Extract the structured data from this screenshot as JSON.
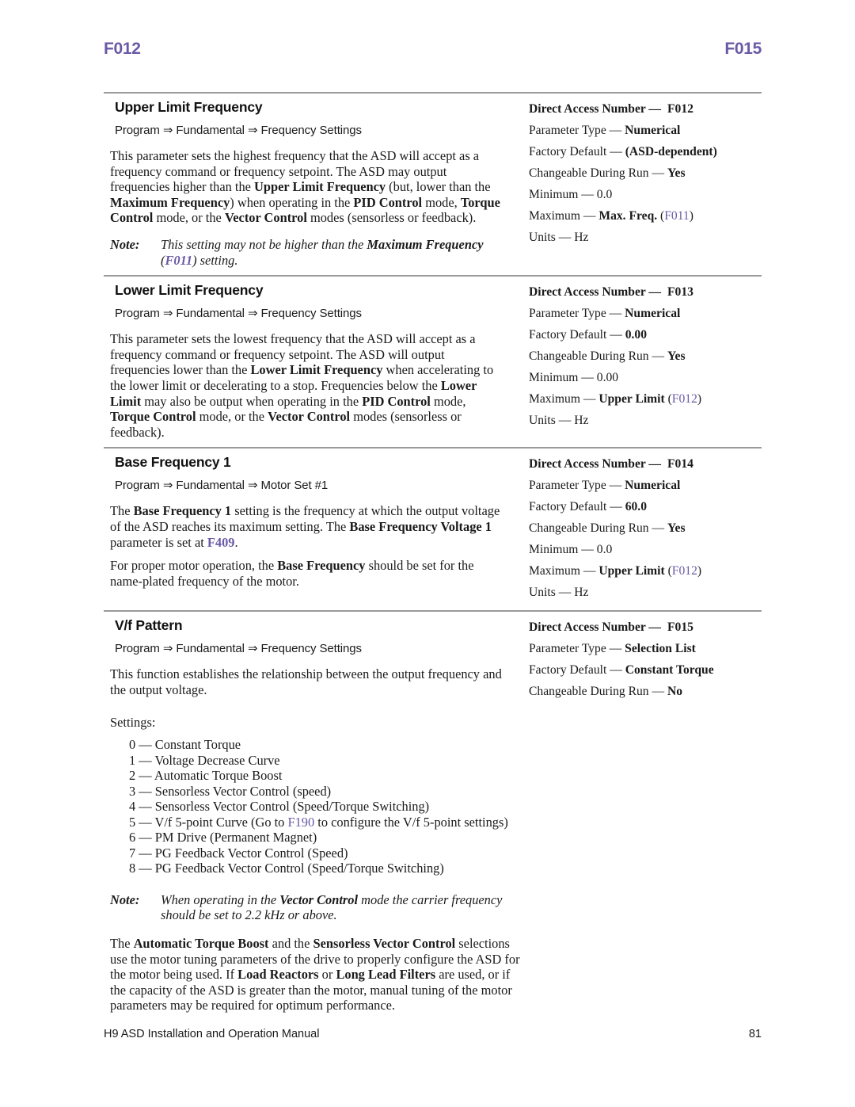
{
  "runhead": {
    "left": "F012",
    "right": "F015"
  },
  "accent_color": "#6a5aa6",
  "rule_color": "#9a9a9a",
  "sections": [
    {
      "title": "Upper Limit Frequency",
      "path": "Program ⇒ Fundamental ⇒ Frequency Settings",
      "spec": {
        "dan_label": "Direct Access Number —",
        "dan_value": "F012",
        "type_label": "Parameter Type —",
        "type_value": "Numerical",
        "default_label": "Factory Default —",
        "default_value": "(ASD-dependent)",
        "run_label": "Changeable During Run —",
        "run_value": "Yes",
        "min_label": "Minimum —",
        "min_value": "0.0",
        "max_label": "Maximum —",
        "max_value": "Max. Freq.",
        "max_ref": "F011",
        "units_label": "Units —",
        "units_value": "Hz"
      }
    },
    {
      "title": "Lower Limit Frequency",
      "path": "Program ⇒ Fundamental ⇒ Frequency Settings",
      "spec": {
        "dan_label": "Direct Access Number —",
        "dan_value": "F013",
        "type_label": "Parameter Type —",
        "type_value": "Numerical",
        "default_label": "Factory Default —",
        "default_value": "0.00",
        "run_label": "Changeable During Run —",
        "run_value": "Yes",
        "min_label": "Minimum —",
        "min_value": "0.00",
        "max_label": "Maximum —",
        "max_value": "Upper Limit",
        "max_ref": "F012",
        "units_label": "Units —",
        "units_value": "Hz"
      }
    },
    {
      "title": "Base Frequency 1",
      "path": "Program ⇒ Fundamental ⇒ Motor Set #1",
      "spec": {
        "dan_label": "Direct Access Number —",
        "dan_value": "F014",
        "type_label": "Parameter Type —",
        "type_value": "Numerical",
        "default_label": "Factory Default —",
        "default_value": "60.0",
        "run_label": "Changeable During Run —",
        "run_value": "Yes",
        "min_label": "Minimum —",
        "min_value": "0.0",
        "max_label": "Maximum —",
        "max_value": "Upper Limit",
        "max_ref": "F012",
        "units_label": "Units —",
        "units_value": "Hz"
      }
    },
    {
      "title": "V/f Pattern",
      "path": "Program ⇒ Fundamental ⇒ Frequency Settings",
      "spec": {
        "dan_label": "Direct Access Number —",
        "dan_value": "F015",
        "type_label": "Parameter Type —",
        "type_value": "Selection List",
        "default_label": "Factory Default —",
        "default_value": "Constant Torque",
        "run_label": "Changeable During Run —",
        "run_value": "No"
      }
    }
  ],
  "note1": {
    "label": "Note:",
    "text_1": "This setting may not be higher than the ",
    "bold_1": "Maximum Frequency",
    "ref": "F011",
    "text_2": " setting."
  },
  "note2": {
    "label": "Note:",
    "text_1": "When operating in the ",
    "bold_1": "Vector Control",
    "text_2": " mode the carrier frequency should be set to 2.2 kHz or above."
  },
  "vf_intro": "This function establishes the relationship between the output frequency and the output voltage.",
  "settings_lead": "Settings:",
  "settings_options": [
    {
      "n": "0 —",
      "label": "Constant Torque"
    },
    {
      "n": "1 —",
      "label": "Voltage Decrease Curve"
    },
    {
      "n": "2 —",
      "label": "Automatic Torque Boost"
    },
    {
      "n": "3 —",
      "label": "Sensorless Vector Control (speed)"
    },
    {
      "n": "4 —",
      "label": "Sensorless Vector Control (Speed/Torque Switching)"
    },
    {
      "n": "5 —",
      "label_pre": "V/f 5-point Curve (Go to ",
      "ref": "F190",
      "label_post": " to configure the V/f 5-point settings)"
    },
    {
      "n": "6 —",
      "label": "PM Drive (Permanent Magnet)"
    },
    {
      "n": "7 —",
      "label": "PG Feedback Vector Control (Speed)"
    },
    {
      "n": "8 —",
      "label": "PG Feedback Vector Control (Speed/Torque Switching)"
    }
  ],
  "footer": {
    "manual": "H9 ASD Installation and Operation Manual",
    "page": "81"
  }
}
